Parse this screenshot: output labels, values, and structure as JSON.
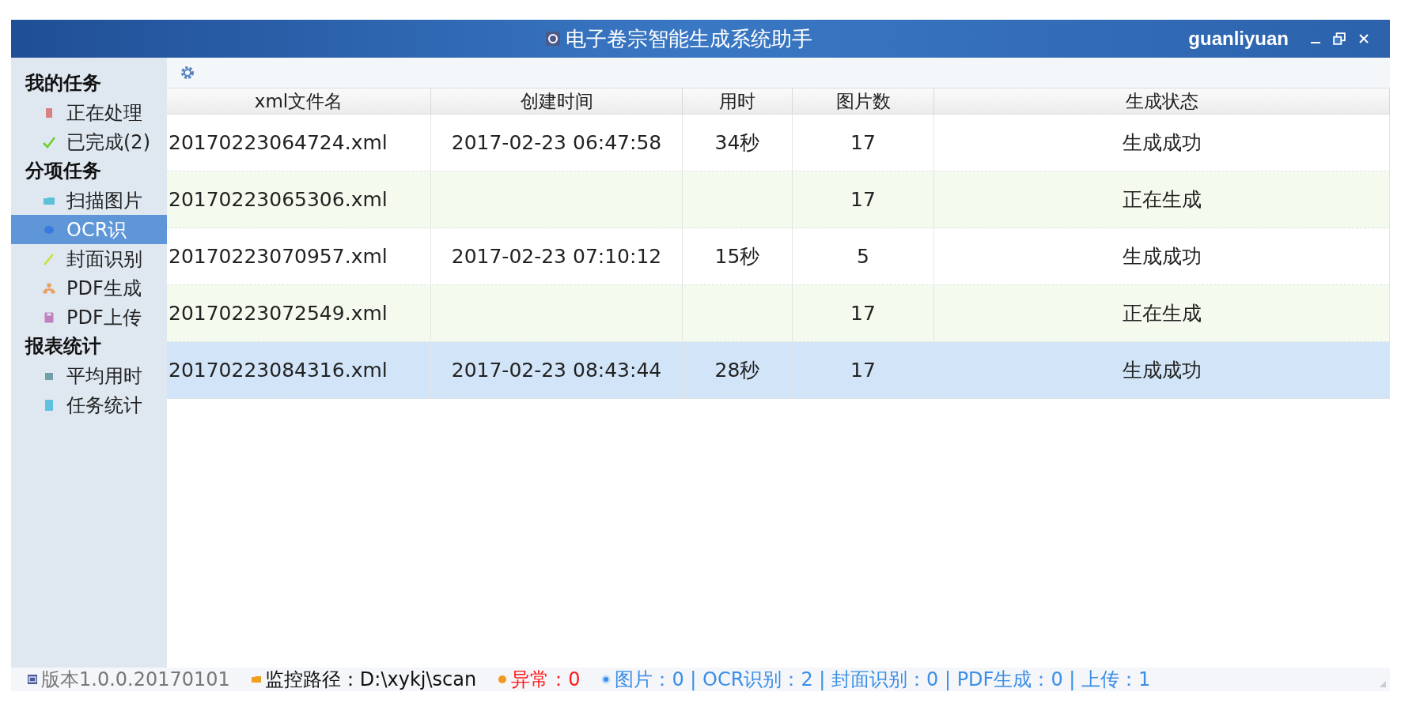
{
  "window": {
    "title": "电子卷宗智能生成系统助手",
    "user": "guanliyuan"
  },
  "sidebar": {
    "groups": [
      {
        "title": "我的任务",
        "items": [
          {
            "label": "正在处理",
            "kind": "processing",
            "selected": false
          },
          {
            "label": "已完成(2)",
            "kind": "done",
            "selected": false
          }
        ]
      },
      {
        "title": "分项任务",
        "items": [
          {
            "label": "扫描图片",
            "kind": "scan",
            "selected": false
          },
          {
            "label": "OCR识",
            "kind": "ocr",
            "selected": true
          },
          {
            "label": "封面识别",
            "kind": "cover",
            "selected": false
          },
          {
            "label": "PDF生成",
            "kind": "pdf",
            "selected": false
          },
          {
            "label": "PDF上传",
            "kind": "upload",
            "selected": false
          }
        ]
      },
      {
        "title": "报表统计",
        "items": [
          {
            "label": "平均用时",
            "kind": "avg",
            "selected": false
          },
          {
            "label": "任务统计",
            "kind": "stats",
            "selected": false
          }
        ]
      }
    ]
  },
  "table": {
    "columns": [
      "xml文件名",
      "创建时间",
      "用时",
      "图片数",
      "生成状态"
    ],
    "rows": [
      {
        "file": "20170223064724.xml",
        "created": "2017-02-23 06:47:58",
        "duration": "34秒",
        "images": "17",
        "status": "生成成功",
        "in_progress": false,
        "selected": false
      },
      {
        "file": "20170223065306.xml",
        "images": "17",
        "status": "正在生成",
        "in_progress": true,
        "selected": false
      },
      {
        "file": "20170223070957.xml",
        "created": "2017-02-23 07:10:12",
        "duration": "15秒",
        "images": "5",
        "status": "生成成功",
        "in_progress": false,
        "selected": false
      },
      {
        "file": "20170223072549.xml",
        "images": "17",
        "status": "正在生成",
        "in_progress": true,
        "selected": false
      },
      {
        "file": "20170223084316.xml",
        "created": "2017-02-23 08:43:44",
        "duration": "28秒",
        "images": "17",
        "status": "生成成功",
        "in_progress": false,
        "selected": true
      }
    ]
  },
  "status_bar": [
    {
      "kind": "version",
      "text": "版本1.0.0.20170101",
      "color": "#777777"
    },
    {
      "kind": "path",
      "text": "监控路径：D:\\xykj\\scan",
      "color": "#111111"
    },
    {
      "kind": "error",
      "text": "异常：0",
      "color": "#ff1a1a"
    },
    {
      "kind": "counts",
      "text": "图片：0 | OCR识别：2 | 封面识别：0 | PDF生成：0 | 上传：1",
      "color": "#3a8ee6"
    }
  ]
}
